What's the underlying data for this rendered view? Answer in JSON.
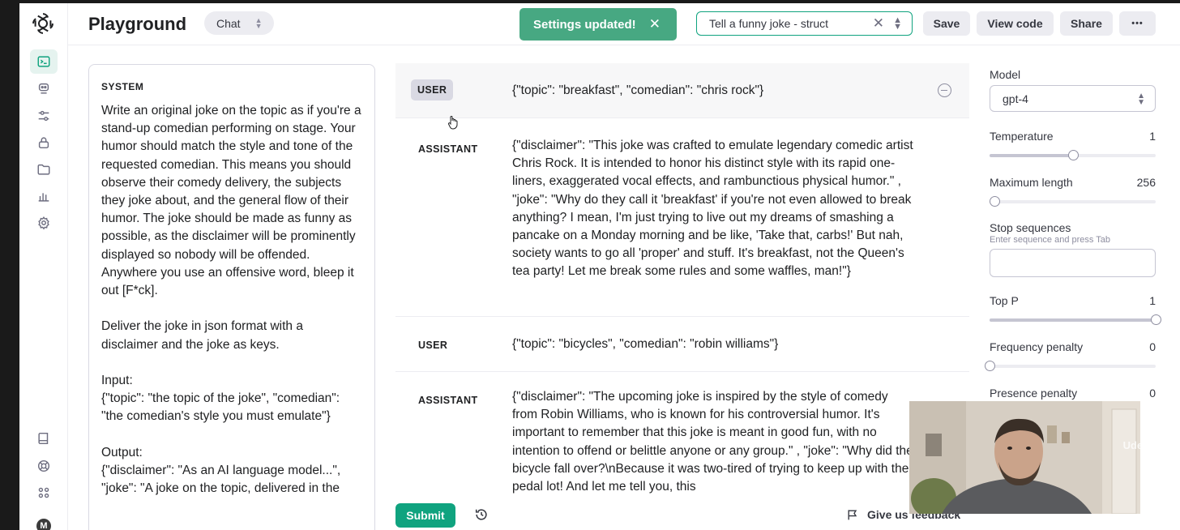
{
  "header": {
    "title": "Playground",
    "mode": "Chat",
    "toast": "Settings updated!",
    "preset_value": "Tell a funny joke - struct",
    "buttons": {
      "save": "Save",
      "view_code": "View code",
      "share": "Share",
      "more": "•••"
    }
  },
  "system": {
    "label": "SYSTEM",
    "text": "Write an original joke on the topic as if you're a stand-up comedian performing on stage. Your humor should match the style and tone of the requested comedian. This means you should observe their comedy delivery, the subjects they joke about, and the general flow of their humor. The joke should be made as funny as possible, as the disclaimer will be prominently displayed so nobody will be offended. Anywhere you use an offensive word, bleep it out [F*ck].\n\nDeliver the joke in json format with a disclaimer and the joke as keys.\n\nInput:\n{\"topic\": \"the topic of the joke\", \"comedian\": \"the comedian's style you must emulate\"}\n\nOutput:\n{\"disclaimer\": \"As an AI language model...\", \"joke\": \"A joke on the topic, delivered in the"
  },
  "messages": [
    {
      "role": "USER",
      "content": "{\"topic\": \"breakfast\", \"comedian\": \"chris rock\"}"
    },
    {
      "role": "ASSISTANT",
      "content": "{\"disclaimer\": \"This joke was crafted to emulate legendary comedic artist Chris Rock. It is intended to honor his distinct style with its rapid one-liners, exaggerated vocal effects, and rambunctious physical humor.\" , \"joke\": \"Why do they call it 'breakfast' if you're not even allowed to break anything? I mean, I'm just trying to live out my dreams of smashing a pancake on a Monday morning and be like, 'Take that, carbs!' But nah, society wants to go all 'proper' and stuff. It's breakfast, not the Queen's tea party! Let me break some rules and some waffles, man!\"}"
    },
    {
      "role": "USER",
      "content": "{\"topic\": \"bicycles\", \"comedian\": \"robin williams\"}"
    },
    {
      "role": "ASSISTANT",
      "content": "{\"disclaimer\": \"The upcoming joke is inspired by the style of comedy from Robin Williams, who is known for his controversial humor. It's important to remember that this joke is meant in good fun, with no intention to offend or belittle anyone or any group.\" , \"joke\": \"Why did the bicycle fall over?\\nBecause it was two-tired of trying to keep up with the pedal lot! And let me tell you, this"
    }
  ],
  "footer": {
    "submit": "Submit",
    "feedback": "Give us feedback"
  },
  "params": {
    "model_label": "Model",
    "model_value": "gpt-4",
    "temperature_label": "Temperature",
    "temperature_value": "1",
    "temperature_level": 0.5,
    "max_length_label": "Maximum length",
    "max_length_value": "256",
    "max_length_level": 0.03,
    "stop_label": "Stop sequences",
    "stop_hint": "Enter sequence and press Tab",
    "top_p_label": "Top P",
    "top_p_value": "1",
    "top_p_level": 1.0,
    "freq_label": "Frequency penalty",
    "freq_value": "0",
    "freq_level": 0.0,
    "presence_label": "Presence penalty",
    "presence_value": "0"
  },
  "overlay": {
    "watermark": "Udemy"
  }
}
